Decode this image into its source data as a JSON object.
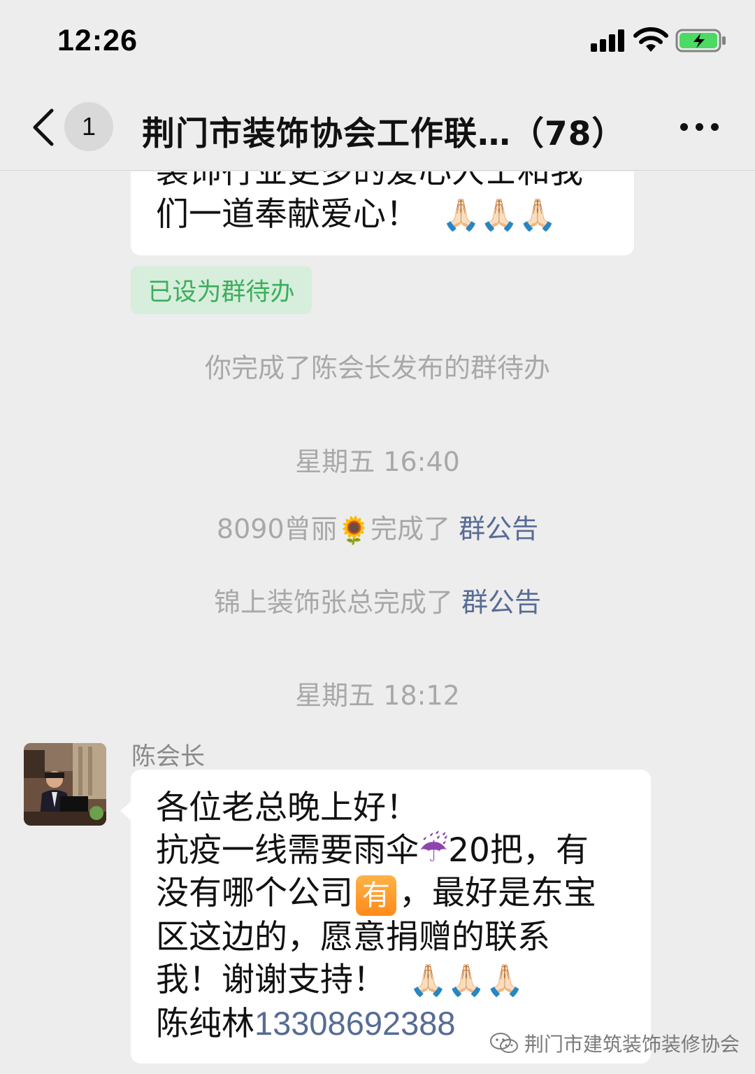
{
  "status_bar": {
    "time": "12:26",
    "icons": [
      "signal-icon",
      "wifi-icon",
      "battery-charging-icon"
    ]
  },
  "nav": {
    "back_icon": "chevron-left-icon",
    "unread_count": "1",
    "title": "荆门市装饰协会工作联…（78）",
    "more_icon": "more-dots-icon"
  },
  "messages": {
    "prev_bubble": {
      "line1": "装饰行业更多的爱心人士和我",
      "line2": "们一道奉献爱心！",
      "emoji": "🙏🏻🙏🏻🙏🏻"
    },
    "todo_tag": "已设为群待办",
    "system_1": "你完成了陈会长发布的群待办",
    "time_1": "星期五 16:40",
    "system_2": {
      "name": "8090曾丽",
      "emoji": "🌻",
      "action": "完成了 ",
      "link": "群公告"
    },
    "system_3": {
      "text": "锦上装饰张总完成了 ",
      "link": "群公告"
    },
    "time_2": "星期五 18:12",
    "main_message": {
      "sender": "陈会长",
      "line1": "各位老总晚上好！",
      "line2_a": "抗疫一线需要雨伞",
      "line2_emoji": "☔",
      "line2_b": "20把，有",
      "line3_a": "没有哪个公司",
      "line3_badge": "有",
      "line3_b": "，最好是东宝",
      "line4": "区这边的，愿意捐赠的联系",
      "line5": "我！谢谢支持！",
      "line5_emoji": "🙏🏻🙏🏻🙏🏻",
      "line6_a": "陈纯林",
      "phone": "13308692388"
    }
  },
  "watermark": {
    "icon": "wechat-icon",
    "text": "荆门市建筑装饰装修协会"
  },
  "colors": {
    "background": "#ededed",
    "bubble": "#ffffff",
    "link": "#576b95",
    "todo_green": "#3dae5c",
    "battery_green": "#4cd964"
  }
}
